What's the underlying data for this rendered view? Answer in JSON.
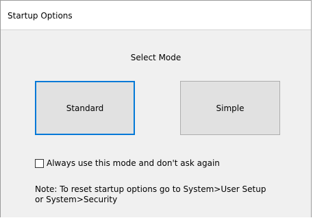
{
  "window": {
    "title": "Startup Options"
  },
  "dialog": {
    "heading": "Select Mode",
    "buttons": {
      "standard": "Standard",
      "simple": "Simple"
    },
    "checkbox": {
      "label": "Always use this mode and don't ask again",
      "checked": false
    },
    "note": {
      "line1": "Note: To reset startup options go to System>User Setup",
      "line2": "or System>Security"
    }
  },
  "colors": {
    "window_background": "#f0f0f0",
    "titlebar_background": "#ffffff",
    "button_background": "#e1e1e1",
    "focus_border": "#0078d7"
  }
}
